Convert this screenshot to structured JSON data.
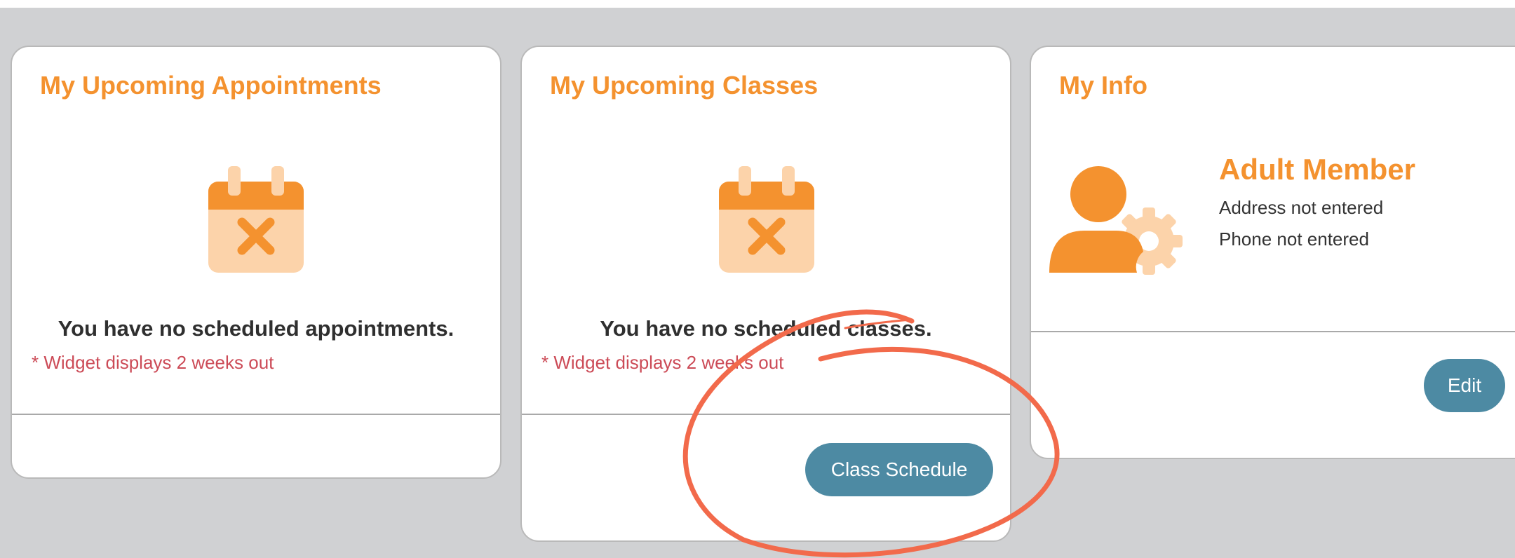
{
  "colors": {
    "accent": "#f4922f",
    "accent_light": "#fcd3aa",
    "button": "#4d8aa3",
    "note": "#cc4b57",
    "annotation": "#f26a4b",
    "background": "#d0d1d3"
  },
  "appointments": {
    "title": "My Upcoming Appointments",
    "icon": "calendar-x-icon",
    "empty_message": "You have no scheduled appointments.",
    "note": "* Widget displays 2 weeks out"
  },
  "classes": {
    "title": "My Upcoming Classes",
    "icon": "calendar-x-icon",
    "empty_message": "You have no scheduled classes.",
    "note": "* Widget displays 2 weeks out",
    "button_label": "Class Schedule"
  },
  "info": {
    "title": "My Info",
    "icon": "user-gear-icon",
    "member_type": "Adult Member",
    "address": "Address not entered",
    "phone": "Phone not entered",
    "edit_label": "Edit"
  },
  "annotation": {
    "shape": "red-circle-annotation",
    "target": "Class Schedule"
  }
}
